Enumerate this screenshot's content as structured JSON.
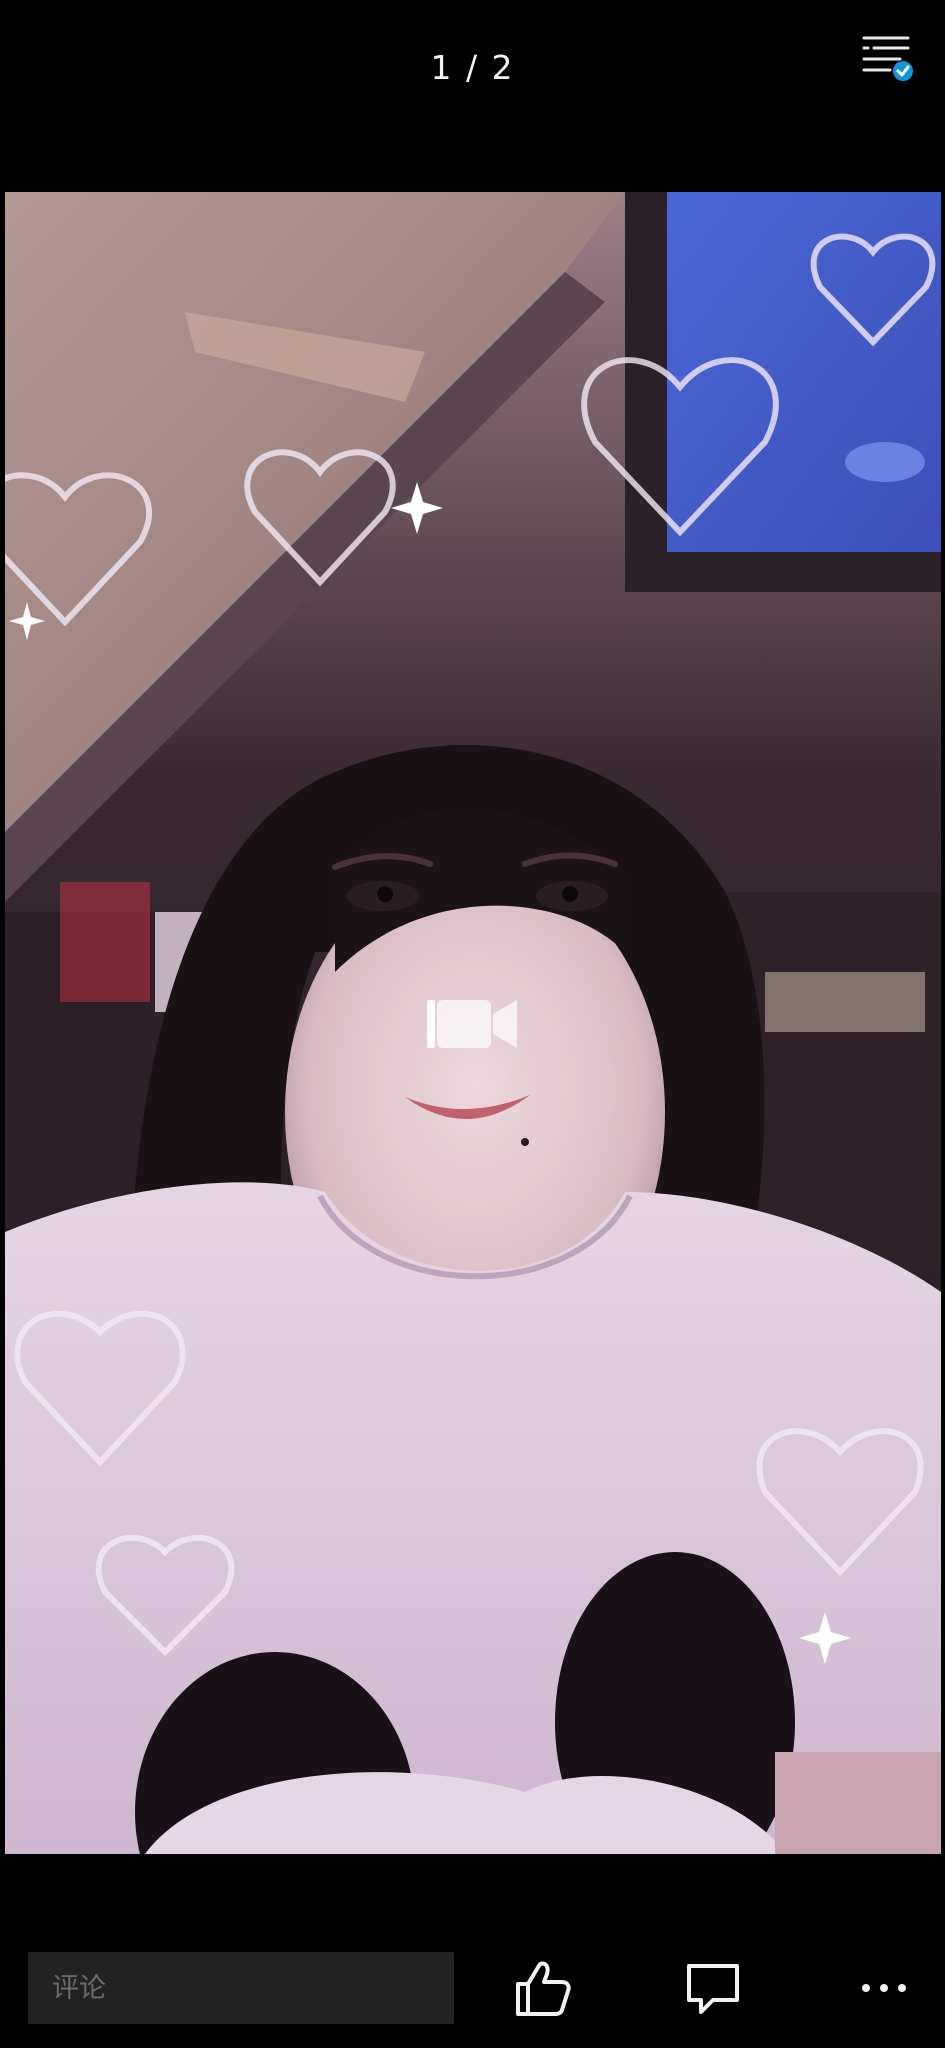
{
  "viewer": {
    "counter": "1 / 2"
  },
  "media": {
    "type_icon": "video-camera-icon"
  },
  "comment": {
    "placeholder": "评论"
  },
  "icons": {
    "list": "list-check-icon",
    "like": "thumbs-up-icon",
    "comment": "comment-bubble-icon",
    "more": "more-dots-icon"
  },
  "colors": {
    "background": "#000000",
    "badge_accent": "#1296db",
    "comment_box": "#222222"
  }
}
